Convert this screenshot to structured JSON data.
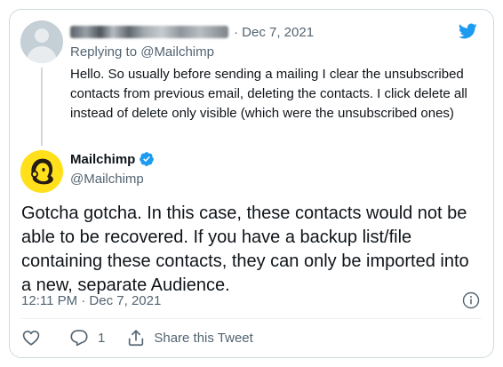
{
  "colors": {
    "twitter_blue": "#1d9bf0",
    "mailchimp_yellow": "#ffe01b",
    "secondary_text": "#536471",
    "border": "#cfd9de"
  },
  "replied_tweet": {
    "date": "· Dec 7, 2021",
    "replying_to": "Replying to @Mailchimp",
    "text": "Hello. So usually before sending a mailing I clear the unsubscribed contacts from previous email, deleting the contacts. I click delete all instead of delete only visible (which were the unsubscribed ones)"
  },
  "main_tweet": {
    "author_name": "Mailchimp",
    "author_handle": "@Mailchimp",
    "text": "Gotcha gotcha. In this case, these contacts would not be able to be recovered. If you have a backup list/file containing these contacts, they can only be imported into a new, separate Audience.",
    "timestamp": "12:11 PM · Dec 7, 2021"
  },
  "actions": {
    "reply_count": "1",
    "share_label": "Share this Tweet"
  },
  "icons": [
    "twitter-bird-icon",
    "verified-badge-icon",
    "info-icon",
    "heart-icon",
    "reply-icon",
    "share-icon"
  ]
}
